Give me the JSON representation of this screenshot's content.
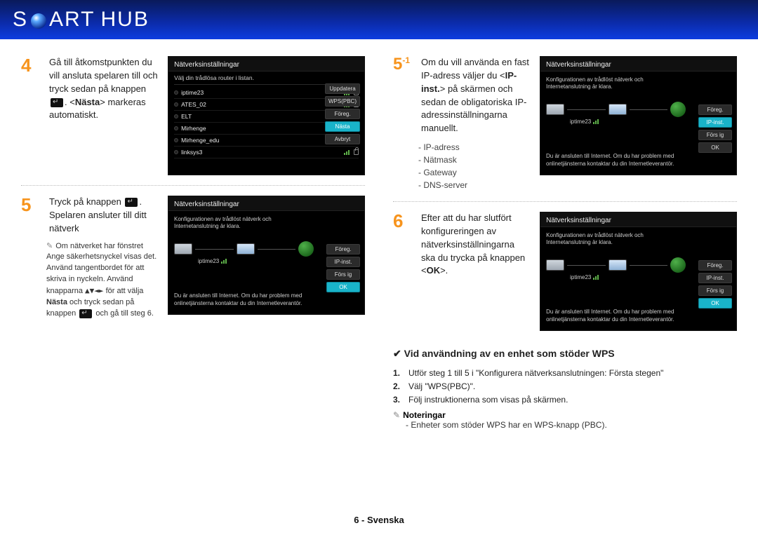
{
  "banner": {
    "brand_left": "S",
    "brand_mid": "ART",
    "brand_right": "HUB"
  },
  "shot_common": {
    "title": "Nätverksinställningar",
    "konfig": "Konfigurationen av trådlöst nätverk och Internetanslutning är klara.",
    "status": "Du är ansluten till Internet. Om du har problem med onlinetjänsterna kontaktar du din Internetleverantör.",
    "ssid": "iptime23"
  },
  "step4": {
    "num": "4",
    "text_a": "Gå till åtkomstpunkten du vill ansluta spelaren till och tryck sedan på knappen ",
    "text_b": ". <",
    "text_c": "Nästa",
    "text_d": "> markeras automatiskt.",
    "list_prompt": "Välj din trådlösa router i listan.",
    "networks": [
      "iptime23",
      "ATES_02",
      "ELT",
      "Mirhenge",
      "Mirhenge_edu",
      "linksys3"
    ],
    "btns": [
      "Uppdatera",
      "WPS(PBC)",
      "Föreg.",
      "Nästa",
      "Avbryt"
    ]
  },
  "step5": {
    "num": "5",
    "text_a": "Tryck på knappen ",
    "text_b": ". Spelaren ansluter till ditt nätverk",
    "note_a": "Om nätverket har fönstret Ange säkerhetsnyckel visas det. Använd tangentbordet för att skriva in nyckeln. Använd knapparna ",
    "note_arrows": "▲▼◄►",
    "note_b": " för att välja ",
    "note_c": "Nästa",
    "note_d": " och tryck sedan på knappen ",
    "note_e": " och gå till steg 6.",
    "btns": [
      "Föreg.",
      "IP-inst.",
      "Förs ig",
      "OK"
    ]
  },
  "step51": {
    "num": "5",
    "sup": "-1",
    "text_a": "Om du vill använda en fast IP-adress väljer du <",
    "text_b": "IP-inst.",
    "text_c": "> på skärmen och sedan de obligatoriska IP-adressinställningarna manuellt.",
    "list": [
      "IP-adress",
      "Nätmask",
      "Gateway",
      "DNS-server"
    ],
    "btns": [
      "Föreg.",
      "IP-inst.",
      "Förs ig",
      "OK"
    ]
  },
  "step6": {
    "num": "6",
    "text_a": "Efter att du har slutfört konfigureringen av nätverksinställningarna ska du trycka på knappen <",
    "text_b": "OK",
    "text_c": ">.",
    "btns": [
      "Föreg.",
      "IP-inst.",
      "Förs ig",
      "OK"
    ]
  },
  "wps": {
    "head": "✔  Vid användning av en enhet som stöder WPS",
    "items": [
      "Utför steg 1 till 5 i \"Konfigurera nätverksanslutningen: Första stegen\"",
      "Välj \"WPS(PBC)\".",
      "Följ instruktionerna som visas på skärmen."
    ],
    "note_label": "Noteringar",
    "note_body": "Enheter som stöder WPS har en WPS-knapp (PBC)."
  },
  "footer": "6 - Svenska"
}
